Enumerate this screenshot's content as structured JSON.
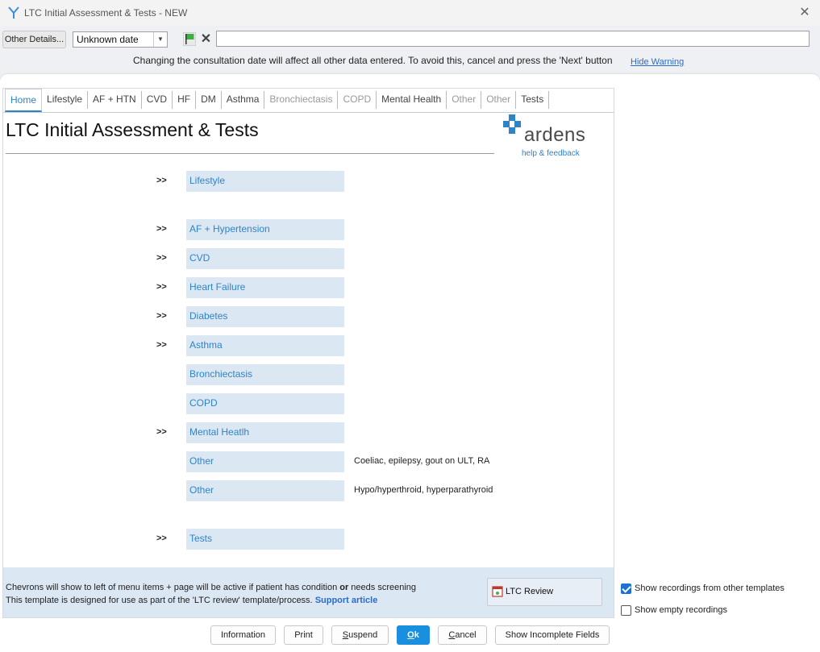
{
  "window": {
    "title": "LTC Initial Assessment & Tests - NEW",
    "close_glyph": "✕"
  },
  "toolbar": {
    "other_details_label": "Other Details...",
    "date_value": "Unknown date",
    "dropdown_glyph": "▼",
    "clear_glyph": "✕",
    "consultation_input_value": "",
    "warning_text": "Changing the consultation date will affect all other data entered. To avoid this, cancel and press the 'Next' button",
    "hide_warning_label": "Hide Warning"
  },
  "tabs": [
    {
      "label": "Home",
      "state": "active"
    },
    {
      "label": "Lifestyle",
      "state": "normal"
    },
    {
      "label": "AF + HTN",
      "state": "normal"
    },
    {
      "label": "CVD",
      "state": "normal"
    },
    {
      "label": "HF",
      "state": "normal"
    },
    {
      "label": "DM",
      "state": "normal"
    },
    {
      "label": "Asthma",
      "state": "normal"
    },
    {
      "label": "Bronchiectasis",
      "state": "disabled"
    },
    {
      "label": "COPD",
      "state": "disabled"
    },
    {
      "label": "Mental Health",
      "state": "normal"
    },
    {
      "label": "Other",
      "state": "disabled"
    },
    {
      "label": "Other",
      "state": "disabled"
    },
    {
      "label": "Tests",
      "state": "normal"
    }
  ],
  "page": {
    "title": "LTC Initial Assessment & Tests",
    "logo_word": "ardens",
    "logo_help": "help & feedback"
  },
  "menu": [
    {
      "chevron": ">>",
      "label": "Lifestyle",
      "note": ""
    },
    {
      "chevron": ">>",
      "label": "AF + Hypertension",
      "note": ""
    },
    {
      "chevron": ">>",
      "label": "CVD",
      "note": ""
    },
    {
      "chevron": ">>",
      "label": "Heart Failure",
      "note": ""
    },
    {
      "chevron": ">>",
      "label": "Diabetes",
      "note": ""
    },
    {
      "chevron": ">>",
      "label": "Asthma",
      "note": ""
    },
    {
      "chevron": "",
      "label": "Bronchiectasis",
      "note": ""
    },
    {
      "chevron": "",
      "label": "COPD",
      "note": ""
    },
    {
      "chevron": ">>",
      "label": "Mental Heatlh",
      "note": ""
    },
    {
      "chevron": "",
      "label": "Other",
      "note": "Coeliac, epilepsy, gout on ULT, RA"
    },
    {
      "chevron": "",
      "label": "Other",
      "note": "Hypo/hyperthroid, hyperparathyroid"
    },
    {
      "chevron": ">>",
      "label": "Tests",
      "note": ""
    }
  ],
  "footer": {
    "line1_a": "Chevrons will show to left of menu items + page will be active if patient has condition ",
    "line1_b": "or",
    "line1_c": " needs screening",
    "line2": "This template is designed for use as part of the 'LTC review' template/process.",
    "support_link": "Support article",
    "ltc_review_label": "LTC Review"
  },
  "options": {
    "show_other_templates": {
      "label": "Show recordings from other templates",
      "checked": true
    },
    "show_empty": {
      "label": "Show empty recordings",
      "checked": false
    }
  },
  "bottom_buttons": {
    "information": "Information",
    "print": "Print",
    "suspend_u": "S",
    "suspend_rest": "uspend",
    "ok_u": "O",
    "ok_rest": "k",
    "cancel_u": "C",
    "cancel_rest": "ancel",
    "incomplete": "Show Incomplete Fields"
  },
  "colors": {
    "accent": "#2f84c6",
    "menu_bg": "#dce7f4",
    "ok_button": "#1a8fe0"
  }
}
